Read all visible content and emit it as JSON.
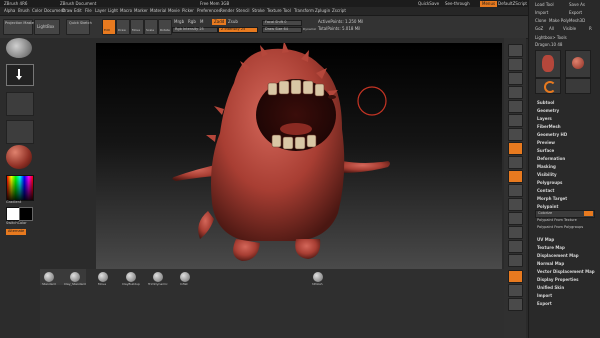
{
  "titlebar": {
    "app_text": "ZBrush 4R6",
    "doc_text": "ZBrush Document",
    "memory_text": "Free Mem 3GB",
    "right_labels": [
      "QuickSave",
      "See-through",
      "Menus",
      "DefaultZScript"
    ]
  },
  "menubar": {
    "items": [
      "Alpha",
      "Brush",
      "Color",
      "Document",
      "Draw",
      "Edit",
      "File",
      "Layer",
      "Light",
      "Macro",
      "Marker",
      "Material",
      "Movie",
      "Picker",
      "Preferences",
      "Render",
      "Stencil",
      "Stroke",
      "Texture",
      "Tool",
      "Transform",
      "Zplugin",
      "Zscript"
    ]
  },
  "toolbar": {
    "projection_label": "Projection Master",
    "lightbox_label": "LightBox",
    "quicksketch_label": "Quick Sketch",
    "mode_buttons": [
      "Edit",
      "Draw",
      "Move",
      "Scale",
      "Rotate"
    ],
    "mrgb_label": "Mrgb",
    "rgb_label": "Rgb",
    "m_label": "M",
    "zadd_label": "Zadd",
    "zsub_label": "Zsub",
    "rgb_intensity_label": "Rgb Intensity 25",
    "z_intensity_label": "Z Intensity 25",
    "focal_shift_label": "Focal Shift 0",
    "draw_size_label": "Draw Size 64",
    "dynamic_label": "Dynamic",
    "active_points_label": "ActivePoints: 1.250 Mil",
    "total_points_label": "TotalPoints: 5.018 Mil"
  },
  "leftshelf": {
    "gradient_label": "Gradient",
    "switchcolor_label": "SwitchColor",
    "alternate_label": "Alternate",
    "primary_color": "#ffffff",
    "secondary_color": "#000000"
  },
  "bottomshelf": {
    "brushes": [
      "Standard",
      "Clay_Standard",
      "Move",
      "ClayBuildup",
      "TrimDynamic",
      "Inflat",
      "hPolish"
    ]
  },
  "tray": {
    "top_buttons": [
      "Load Tool",
      "Save As",
      "Import",
      "Export",
      "Clone",
      "Make PolyMesh3D",
      "GoZ",
      "All",
      "Visible",
      "R"
    ],
    "lightbox_tools": "Lightbox> Tools",
    "tool_name": "Dragon.10 48",
    "panels": [
      "Subtool",
      "Geometry",
      "Layers",
      "FiberMesh",
      "Geometry HD",
      "Preview",
      "Surface",
      "Deformation",
      "Masking",
      "Visibility",
      "Polygroups",
      "Contact",
      "Morph Target",
      "Polypaint",
      "Colorize",
      "Polypaint From Texture",
      "Polypaint From Polygroups",
      "UV Map",
      "Texture Map",
      "Displacement Map",
      "Normal Map",
      "Vector Displacement Map",
      "Display Properties",
      "Unified Skin",
      "Import",
      "Export"
    ]
  },
  "viewport": {
    "bg_top": "#000000",
    "bg_bottom": "#4a4a4a",
    "model_color": "#b5473b",
    "accent": "#e87a1f"
  }
}
